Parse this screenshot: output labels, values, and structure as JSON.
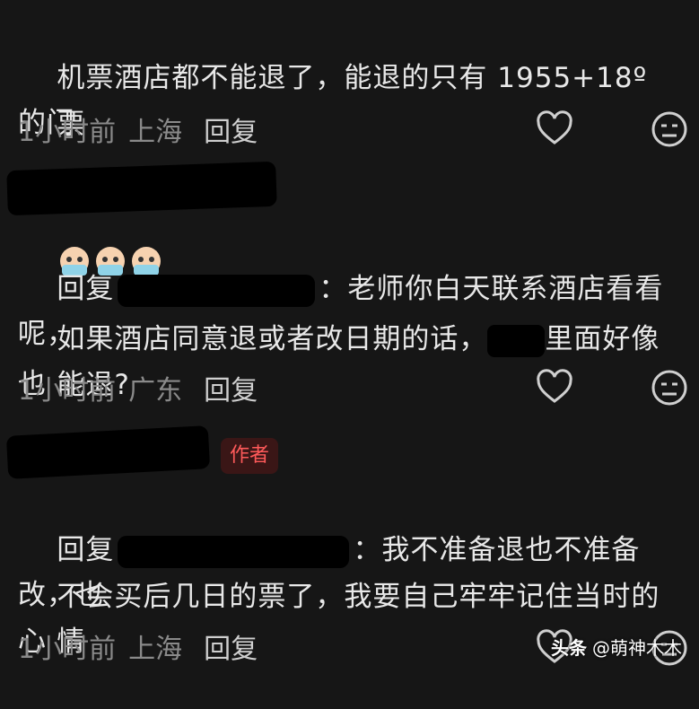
{
  "comments": [
    {
      "text_line1": "机票酒店都不能退了，能退的只有 1955+18º 的门",
      "text_line2": "票",
      "time": "1小时前",
      "location": "上海",
      "reply_label": "回复"
    },
    {
      "reply_prefix": "回复",
      "text_line1": "：老师你白天联系酒店看看呢，",
      "text_line2": "如果酒店同意退或者改日期的话，",
      "text_line2b": "里面好像也",
      "text_line3": "能退?",
      "time": "1小时前",
      "location": "广东",
      "reply_label": "回复"
    },
    {
      "author_badge": "作者",
      "reply_prefix": "回复",
      "text_line1": "：我不准备退也不准备改，也",
      "text_line2": "不会买后几日的票了，我要自己牢牢记住当时的心",
      "text_line3": "情",
      "time": "1小时前",
      "location": "上海",
      "reply_label": "回复"
    }
  ],
  "watermark": {
    "brand": "头条",
    "handle": "@萌神木木"
  }
}
